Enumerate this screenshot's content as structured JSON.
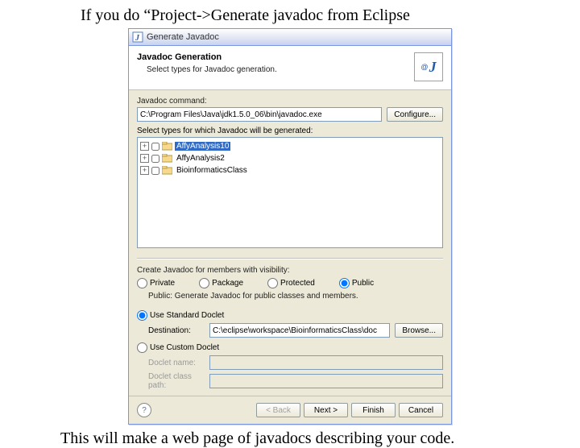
{
  "captions": {
    "top": "If you do “Project->Generate javadoc from Eclipse",
    "bottom": "This will make a web page of javadocs describing your code."
  },
  "dialog": {
    "title": "Generate Javadoc",
    "icon_letter": "J"
  },
  "banner": {
    "title": "Javadoc Generation",
    "subtitle": "Select types for Javadoc generation.",
    "icon_letter": "J"
  },
  "javadoc_cmd": {
    "label": "Javadoc command:",
    "value": "C:\\Program Files\\Java\\jdk1.5.0_06\\bin\\javadoc.exe",
    "configure": "Configure..."
  },
  "types": {
    "label": "Select types for which Javadoc will be generated:",
    "items": [
      {
        "name": "AffyAnalysis10",
        "selected": true
      },
      {
        "name": "AffyAnalysis2",
        "selected": false
      },
      {
        "name": "BioinformaticsClass",
        "selected": false
      }
    ]
  },
  "visibility": {
    "label": "Create Javadoc for members with visibility:",
    "options": [
      "Private",
      "Package",
      "Protected",
      "Public"
    ],
    "selected": "Public",
    "desc": "Public: Generate Javadoc for public classes and members."
  },
  "doclet": {
    "std_label": "Use Standard Doclet",
    "custom_label": "Use Custom Doclet",
    "use_standard": true,
    "dest_label": "Destination:",
    "dest_value": "C:\\eclipse\\workspace\\BioinformaticsClass\\doc",
    "browse": "Browse...",
    "name_label": "Doclet name:",
    "name_value": "",
    "class_label": "Doclet class path:",
    "class_value": ""
  },
  "footer": {
    "help": "?",
    "back": "< Back",
    "next": "Next >",
    "finish": "Finish",
    "cancel": "Cancel"
  }
}
